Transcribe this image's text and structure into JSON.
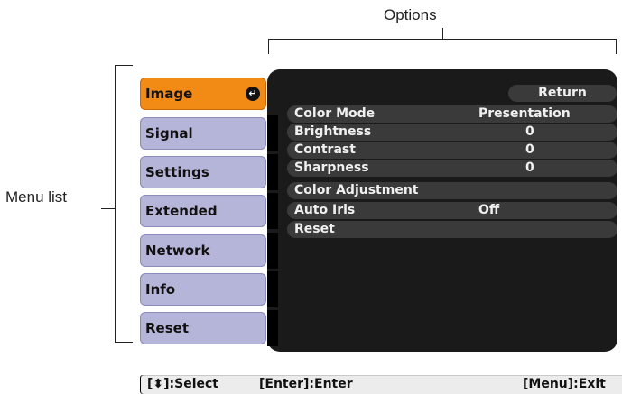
{
  "callouts": {
    "options_label": "Options",
    "menu_list_label": "Menu list"
  },
  "menu": {
    "items": [
      {
        "label": "Image",
        "selected": true
      },
      {
        "label": "Signal",
        "selected": false
      },
      {
        "label": "Settings",
        "selected": false
      },
      {
        "label": "Extended",
        "selected": false
      },
      {
        "label": "Network",
        "selected": false
      },
      {
        "label": "Info",
        "selected": false
      },
      {
        "label": "Reset",
        "selected": false
      }
    ],
    "selected_icon": "enter-icon"
  },
  "options": {
    "return_label": "Return",
    "rows": [
      {
        "label": "Color Mode",
        "value": "Presentation"
      },
      {
        "label": "Brightness",
        "value": "0"
      },
      {
        "label": "Contrast",
        "value": "0"
      },
      {
        "label": "Sharpness",
        "value": "0"
      },
      {
        "label": "Color Adjustment",
        "value": ""
      },
      {
        "label": "Auto Iris",
        "value": "Off"
      },
      {
        "label": "Reset",
        "value": ""
      }
    ]
  },
  "help_bar": {
    "select": "[⬍]:Select",
    "enter": "[Enter]:Enter",
    "exit": "[Menu]:Exit"
  },
  "colors": {
    "selected_item": "#f28a16",
    "menu_item": "#b5b5d9",
    "panel": "#1a1a1a",
    "row": "#3a3a3a"
  }
}
